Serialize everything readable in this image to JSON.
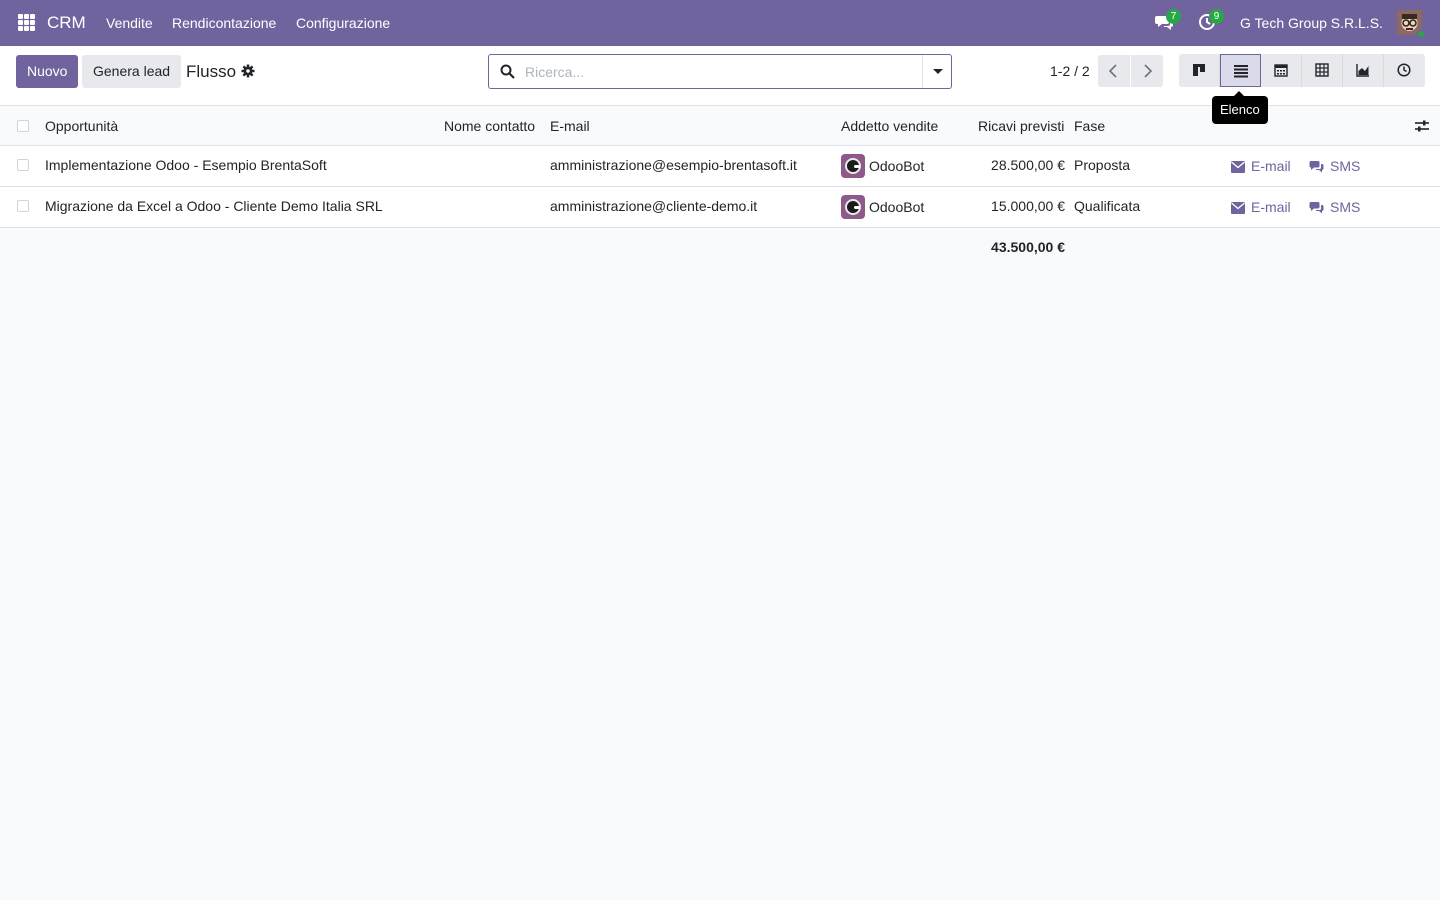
{
  "navbar": {
    "app_name": "CRM",
    "menu": [
      "Vendite",
      "Rendicontazione",
      "Configurazione"
    ],
    "messages_count": "7",
    "activities_count": "9",
    "company": "G Tech Group S.R.L.S."
  },
  "control": {
    "new_button": "Nuovo",
    "generate_button": "Genera lead",
    "breadcrumb": "Flusso",
    "search_placeholder": "Ricerca...",
    "pager": "1-2 / 2",
    "views": [
      "kanban",
      "list",
      "calendar",
      "pivot",
      "graph",
      "activity"
    ],
    "active_view": "list",
    "tooltip": "Elenco"
  },
  "table": {
    "headers": {
      "opportunity": "Opportunità",
      "contact": "Nome contatto",
      "email": "E-mail",
      "salesperson": "Addetto vendite",
      "revenue": "Ricavi previsti",
      "stage": "Fase"
    },
    "rows": [
      {
        "opportunity": "Implementazione Odoo - Esempio BrentaSoft",
        "contact": "",
        "email": "amministrazione@esempio-brentasoft.it",
        "salesperson": "OdooBot",
        "revenue": "28.500,00 €",
        "stage": "Proposta",
        "email_action": "E-mail",
        "sms_action": "SMS"
      },
      {
        "opportunity": "Migrazione da Excel a Odoo - Cliente Demo Italia SRL",
        "contact": "",
        "email": "amministrazione@cliente-demo.it",
        "salesperson": "OdooBot",
        "revenue": "15.000,00 €",
        "stage": "Qualificata",
        "email_action": "E-mail",
        "sms_action": "SMS"
      }
    ],
    "total_revenue": "43.500,00 €"
  },
  "colors": {
    "brand": "#71639e",
    "badge": "#28a745"
  }
}
